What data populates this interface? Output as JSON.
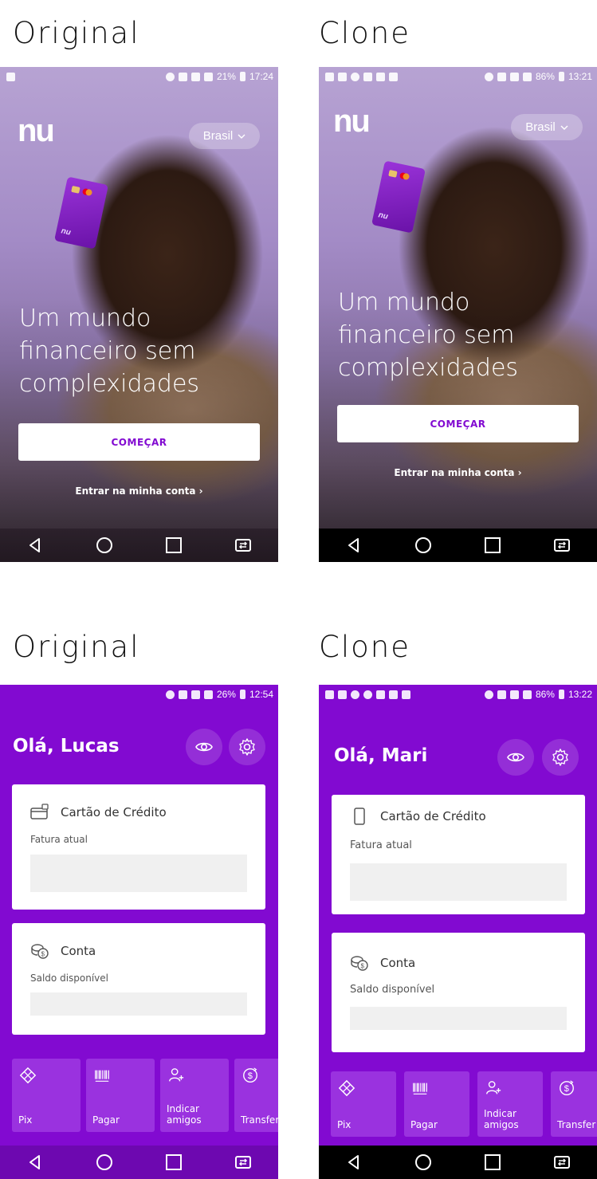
{
  "captions": {
    "original": "Original",
    "clone": "Clone"
  },
  "welcome": {
    "original": {
      "status": {
        "battery": "21%",
        "time": "17:24"
      },
      "logo": "nu",
      "country": "Brasil",
      "headline": [
        "Um mundo",
        "financeiro sem",
        "complexidades"
      ],
      "start_button": "COMEÇAR",
      "login_link": "Entrar na minha conta ›"
    },
    "clone": {
      "status": {
        "battery": "86%",
        "time": "13:21"
      },
      "logo": "nu",
      "country": "Brasil",
      "headline": [
        "Um mundo",
        "financeiro sem",
        "complexidades"
      ],
      "start_button": "COMEÇAR",
      "login_link": "Entrar na minha conta ›"
    }
  },
  "home": {
    "original": {
      "status": {
        "battery": "26%",
        "time": "12:54"
      },
      "greeting": "Olá, Lucas",
      "credit_card": {
        "title": "Cartão de Crédito",
        "subtitle": "Fatura atual"
      },
      "account": {
        "title": "Conta",
        "subtitle": "Saldo disponível"
      },
      "shortcuts": [
        "Pix",
        "Pagar",
        "Indicar\namigos",
        "Transfer"
      ]
    },
    "clone": {
      "status": {
        "battery": "86%",
        "time": "13:22"
      },
      "greeting": "Olá, Mari",
      "credit_card": {
        "title": "Cartão de Crédito",
        "subtitle": "Fatura atual"
      },
      "account": {
        "title": "Conta",
        "subtitle": "Saldo disponível"
      },
      "shortcuts": [
        "Pix",
        "Pagar",
        "Indicar\namigos",
        "Transfer"
      ]
    }
  },
  "colors": {
    "nubank_purple": "#820ad1",
    "shortcut_purple": "#9a32df"
  }
}
